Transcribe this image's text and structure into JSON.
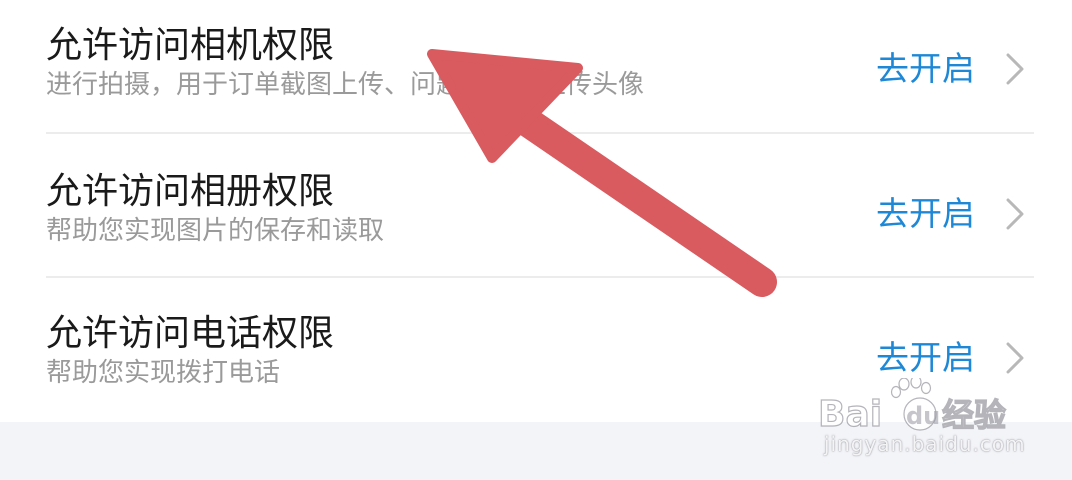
{
  "colors": {
    "action": "#1e88d6",
    "title": "#1a1a1a",
    "subtitle": "#9a9a9a",
    "chevron": "#b8b8b8",
    "divider": "#ececec",
    "arrow": "#d95a5f",
    "footer_background": "#f3f4f8"
  },
  "permissions": {
    "camera": {
      "title": "允许访问相机权限",
      "subtitle": "进行拍摄，用于订单截图上传、问题反馈、上传头像",
      "action_label": "去开启",
      "action_icon": "chevron-right-icon"
    },
    "album": {
      "title": "允许访问相册权限",
      "subtitle": "帮助您实现图片的保存和读取",
      "action_label": "去开启",
      "action_icon": "chevron-right-icon"
    },
    "phone": {
      "title": "允许访问电话权限",
      "subtitle": "帮助您实现拨打电话",
      "action_label": "去开启",
      "action_icon": "chevron-right-icon"
    }
  },
  "annotation": {
    "icon": "pointer-arrow-icon"
  },
  "watermark": {
    "logo_text": "Bai du 经验",
    "url": "jingyan.baidu.com"
  }
}
